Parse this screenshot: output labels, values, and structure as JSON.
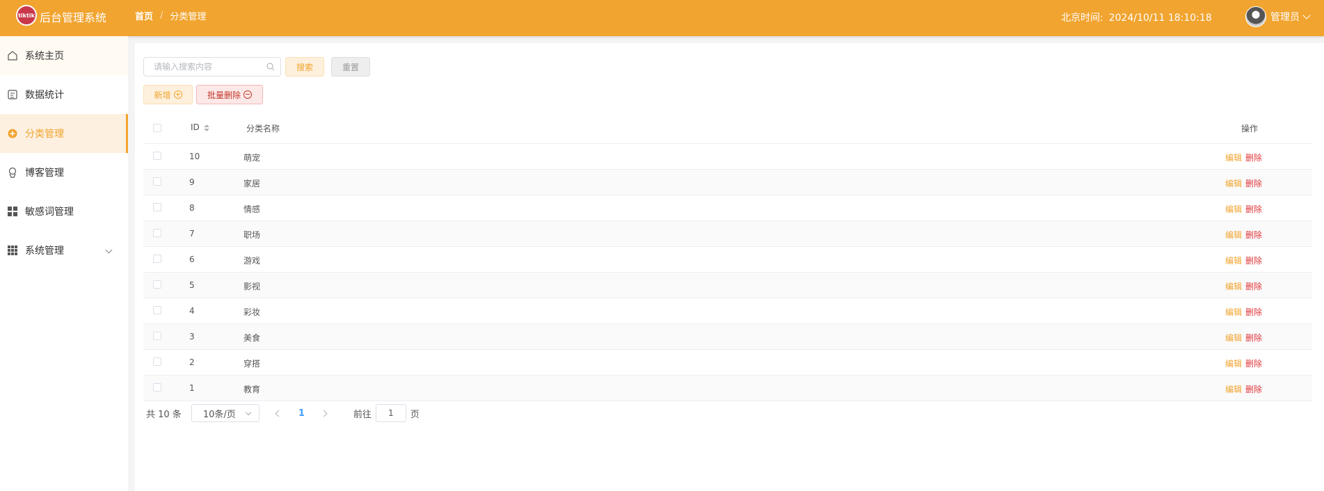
{
  "header": {
    "logo_text": "tiktik",
    "app_title": "后台管理系统",
    "breadcrumb": {
      "home": "首页",
      "separator": "/",
      "current": "分类管理"
    },
    "clock_label": "北京时间:",
    "clock_value": "2024/10/11 18:10:18",
    "user_name": "管理员"
  },
  "sidebar": {
    "items": [
      {
        "label": "系统主页",
        "icon": "home-icon"
      },
      {
        "label": "数据统计",
        "icon": "chart-icon"
      },
      {
        "label": "分类管理",
        "icon": "category-icon",
        "active": true
      },
      {
        "label": "博客管理",
        "icon": "blog-icon"
      },
      {
        "label": "敏感词管理",
        "icon": "grid-icon"
      },
      {
        "label": "系统管理",
        "icon": "apps-icon",
        "expandable": true
      }
    ]
  },
  "toolbar": {
    "search_placeholder": "请输入搜索内容",
    "search_label": "搜索",
    "reset_label": "重置",
    "add_label": "新增",
    "batch_delete_label": "批量删除"
  },
  "table": {
    "headers": {
      "id": "ID",
      "name": "分类名称",
      "ops": "操作"
    },
    "edit_label": "编辑",
    "delete_label": "删除",
    "rows": [
      {
        "id": "10",
        "name": "萌宠"
      },
      {
        "id": "9",
        "name": "家居"
      },
      {
        "id": "8",
        "name": "情感"
      },
      {
        "id": "7",
        "name": "职场"
      },
      {
        "id": "6",
        "name": "游戏"
      },
      {
        "id": "5",
        "name": "影视"
      },
      {
        "id": "4",
        "name": "彩妆"
      },
      {
        "id": "3",
        "name": "美食"
      },
      {
        "id": "2",
        "name": "穿搭"
      },
      {
        "id": "1",
        "name": "教育"
      }
    ]
  },
  "pagination": {
    "total_text": "共 10 条",
    "page_size": "10条/页",
    "current_page": "1",
    "goto_label": "前往",
    "goto_value": "1",
    "page_suffix": "页"
  },
  "colors": {
    "accent": "#f1a42f",
    "danger": "#e0393e",
    "active_page": "#409eff"
  }
}
